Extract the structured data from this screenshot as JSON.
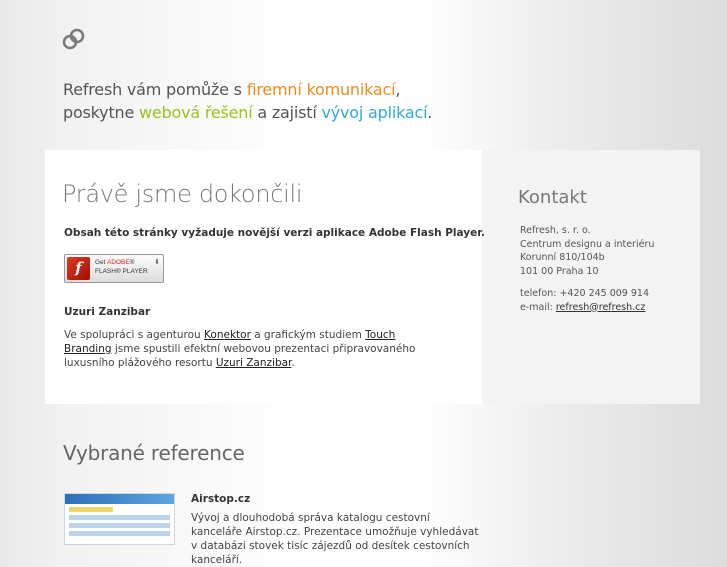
{
  "header": {
    "logo_icon": "refresh-logo-icon",
    "tagline_l1_a": "Refresh vám pomůže s ",
    "tagline_l1_b": "firemní komunikací",
    "tagline_l1_c": ",",
    "tagline_l2_a": "poskytne ",
    "tagline_l2_b": "webová řešení",
    "tagline_l2_c": " a zajistí ",
    "tagline_l2_d": "vývoj aplikací",
    "tagline_l2_e": ".",
    "colors": {
      "orange": "#ef8a1d",
      "green": "#9bc21d",
      "blue": "#31a9dc"
    }
  },
  "main": {
    "heading": "Právě jsme dokončili",
    "flash_message": "Obsah této stránky vyžaduje novější verzi aplikace Adobe Flash Player.",
    "flash_button": {
      "get": "Get ",
      "adobe": "ADOBE",
      "reg": "®",
      "player": "FLASH® PLAYER",
      "icon": "flash-player-icon",
      "arrow_icon": "download-arrow-icon"
    },
    "project_title": "Uzuri Zanzibar",
    "project_text": {
      "t1": "Ve spolupráci s agenturou ",
      "link1": "Konektor",
      "t2": " a grafickým studiem ",
      "link2": "Touch Branding",
      "t3": " jsme spustili efektní webovou prezentaci připravovaného luxusního plážového resortu ",
      "link3": "Uzuri Zanzibar",
      "t4": "."
    }
  },
  "contact": {
    "heading": "Kontakt",
    "address": [
      "Refresh, s. r. o.",
      "Centrum designu a interiéru",
      "Korunní 810/104b",
      "101 00 Praha 10"
    ],
    "phone": "telefon: +420 245 009 914",
    "email_label": "e-mail: ",
    "email": "refresh@refresh.cz"
  },
  "references": {
    "heading": "Vybrané reference",
    "items": [
      {
        "title": "Airstop.cz",
        "text": "Vývoj a dlouhodobá správa katalogu cestovní kanceláře Airstop.cz. Prezentace umožňuje vyhledávat v databázi stovek tisíc zájezdů od desítek cestovních kanceláří."
      }
    ]
  }
}
